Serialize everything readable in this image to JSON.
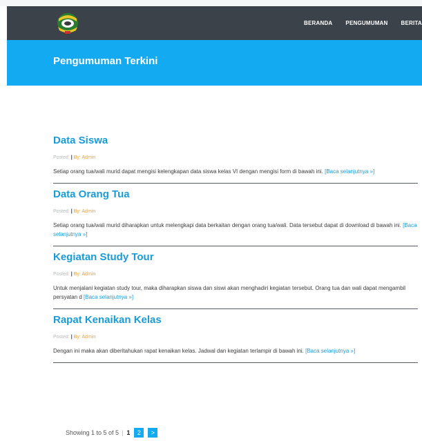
{
  "nav": {
    "items": [
      "BERANDA",
      "PENGUMUMAN",
      "BERITA"
    ]
  },
  "hero": {
    "title": "Pengumuman Terkini"
  },
  "posts": [
    {
      "title": "Data Siswa",
      "posted_label": "Posted:",
      "by_label": "By: Admin",
      "excerpt": "Setiap orang tua/wali murid dapat mengisi kelengkapan data siswa kelas VI dengan mengisi form di bawah ini.",
      "more": "[Baca selanjutnya »]"
    },
    {
      "title": "Data Orang Tua",
      "posted_label": "Posted:",
      "by_label": "By: Admin",
      "excerpt": "Setiap orang tua/wali murid diharapkan untuk melengkapi data berkaitan dengan orang tua/wali. Data tersebut dapat di download di bawah ini.",
      "more": "[Baca selanjutnya »]"
    },
    {
      "title": "Kegiatan Study Tour",
      "posted_label": "Posted:",
      "by_label": "By: Admin",
      "excerpt": "Untuk menjalani kegiatan study tour, maka diharapkan siswa dan siswi akan menghadiri kegiatan tersebut. Orang tua dan wali dapat mengambil persyatan d",
      "more": "[Baca selanjutnya »]"
    },
    {
      "title": "Rapat Kenaikan Kelas",
      "posted_label": "Posted:",
      "by_label": "By: Admin",
      "excerpt": "Dengan ini maka akan diberitahukan rapat kenaikan kelas. Jadwal dan kegiatan terlampir di bawah ini.",
      "more": "[Baca selanjutnya »]"
    }
  ],
  "pagination": {
    "summary": "Showing 1 to 5 of 5",
    "separator": "|",
    "current": "1",
    "page2": "2",
    "next": ">"
  },
  "colors": {
    "navbar": "#3c4249",
    "hero": "#13aaf2",
    "title_link": "#1a9bd7",
    "author": "#f0a030"
  },
  "icons": {
    "logo": "school-emblem-icon"
  }
}
